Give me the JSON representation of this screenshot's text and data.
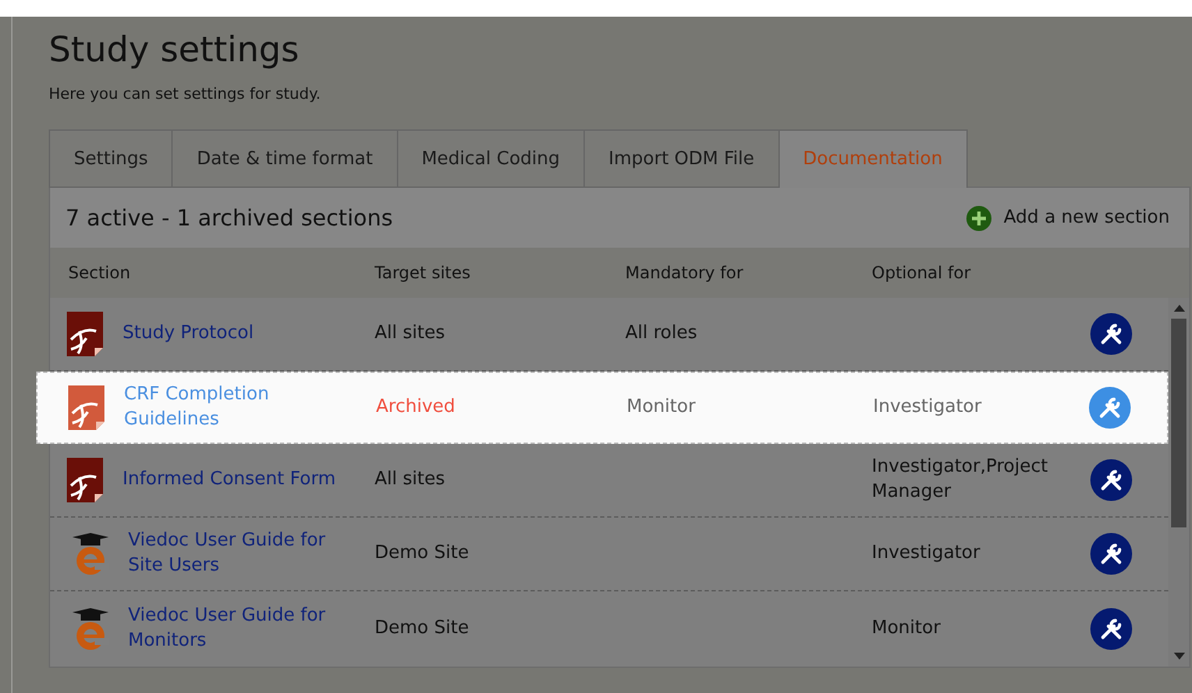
{
  "page": {
    "title": "Study settings",
    "subtitle": "Here you can set settings for study."
  },
  "tabs": [
    {
      "label": "Settings",
      "selected": false
    },
    {
      "label": "Date & time format",
      "selected": false
    },
    {
      "label": "Medical Coding",
      "selected": false
    },
    {
      "label": "Import ODM File",
      "selected": false
    },
    {
      "label": "Documentation",
      "selected": true
    }
  ],
  "panel": {
    "summary": "7 active - 1 archived sections",
    "add_button": "Add a new section"
  },
  "table": {
    "columns": [
      "Section",
      "Target sites",
      "Mandatory for",
      "Optional for"
    ],
    "rows": [
      {
        "kind": "pdf",
        "section": "Study Protocol",
        "target_sites": "All sites",
        "archived": false,
        "mandatory_for": "All roles",
        "optional_for": "",
        "selected": false
      },
      {
        "kind": "pdf",
        "section": "CRF Completion Guidelines",
        "target_sites": "Archived",
        "archived": true,
        "mandatory_for": "Monitor",
        "optional_for": "Investigator",
        "selected": true
      },
      {
        "kind": "pdf",
        "section": "Informed Consent Form",
        "target_sites": "All sites",
        "archived": false,
        "mandatory_for": "",
        "optional_for": "Investigator,Project Manager",
        "selected": false
      },
      {
        "kind": "elearning",
        "section": "Viedoc User Guide for Site Users",
        "target_sites": "Demo Site",
        "archived": false,
        "mandatory_for": "",
        "optional_for": "Investigator",
        "selected": false
      },
      {
        "kind": "elearning",
        "section": "Viedoc User Guide for Monitors",
        "target_sites": "Demo Site",
        "archived": false,
        "mandatory_for": "",
        "optional_for": "Monitor",
        "selected": false
      }
    ]
  }
}
